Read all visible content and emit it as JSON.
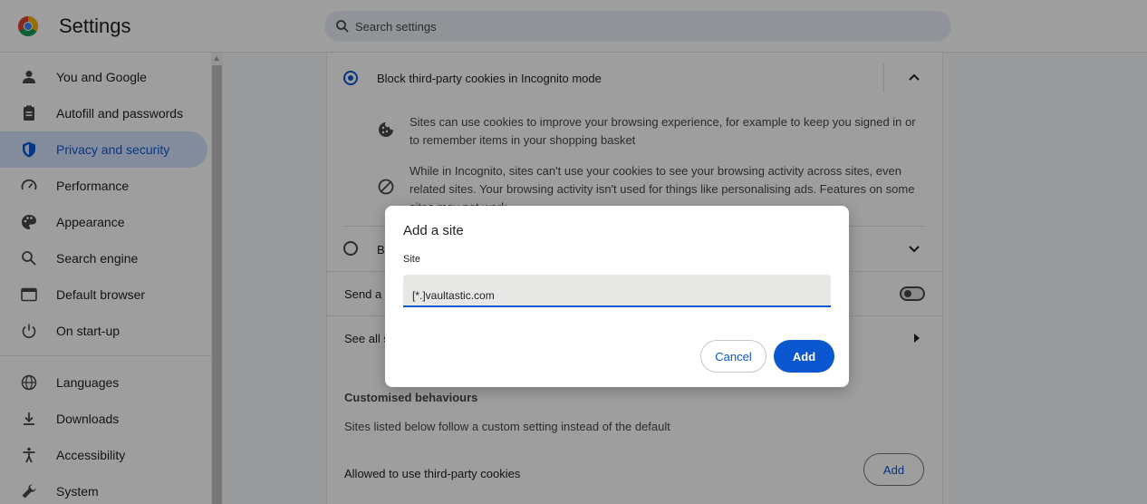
{
  "app": {
    "title": "Settings"
  },
  "search": {
    "placeholder": "Search settings"
  },
  "sidebar": {
    "items": [
      {
        "label": "You and Google",
        "icon": "person-icon"
      },
      {
        "label": "Autofill and passwords",
        "icon": "clipboard-icon"
      },
      {
        "label": "Privacy and security",
        "icon": "shield-icon",
        "active": true
      },
      {
        "label": "Performance",
        "icon": "speedometer-icon"
      },
      {
        "label": "Appearance",
        "icon": "palette-icon"
      },
      {
        "label": "Search engine",
        "icon": "search-icon"
      },
      {
        "label": "Default browser",
        "icon": "browser-icon"
      },
      {
        "label": "On start-up",
        "icon": "power-icon"
      },
      {
        "label": "Languages",
        "icon": "globe-icon"
      },
      {
        "label": "Downloads",
        "icon": "download-icon"
      },
      {
        "label": "Accessibility",
        "icon": "accessibility-icon"
      },
      {
        "label": "System",
        "icon": "wrench-icon"
      }
    ]
  },
  "main": {
    "option_block_incognito": "Block third-party cookies in Incognito mode",
    "detail_1": "Sites can use cookies to improve your browsing experience, for example to keep you signed in or to remember items in your shopping basket",
    "detail_2": "While in Incognito, sites can't use your cookies to see your browsing activity across sites, even related sites. Your browsing activity isn't used for things like personalising ads. Features on some sites may not work",
    "option_block_all": "Bl",
    "send_request": "Send a",
    "see_all": "See all s",
    "customised_heading": "Customised behaviours",
    "customised_desc": "Sites listed below follow a custom setting instead of the default",
    "allowed_label": "Allowed to use third-party cookies",
    "allowed_add": "Add"
  },
  "dialog": {
    "title": "Add a site",
    "field_label": "Site",
    "field_value": "[*.]vaultastic.com",
    "cancel": "Cancel",
    "add": "Add"
  },
  "colors": {
    "accent": "#0b57d0",
    "active_bg": "#d3e3fd"
  }
}
